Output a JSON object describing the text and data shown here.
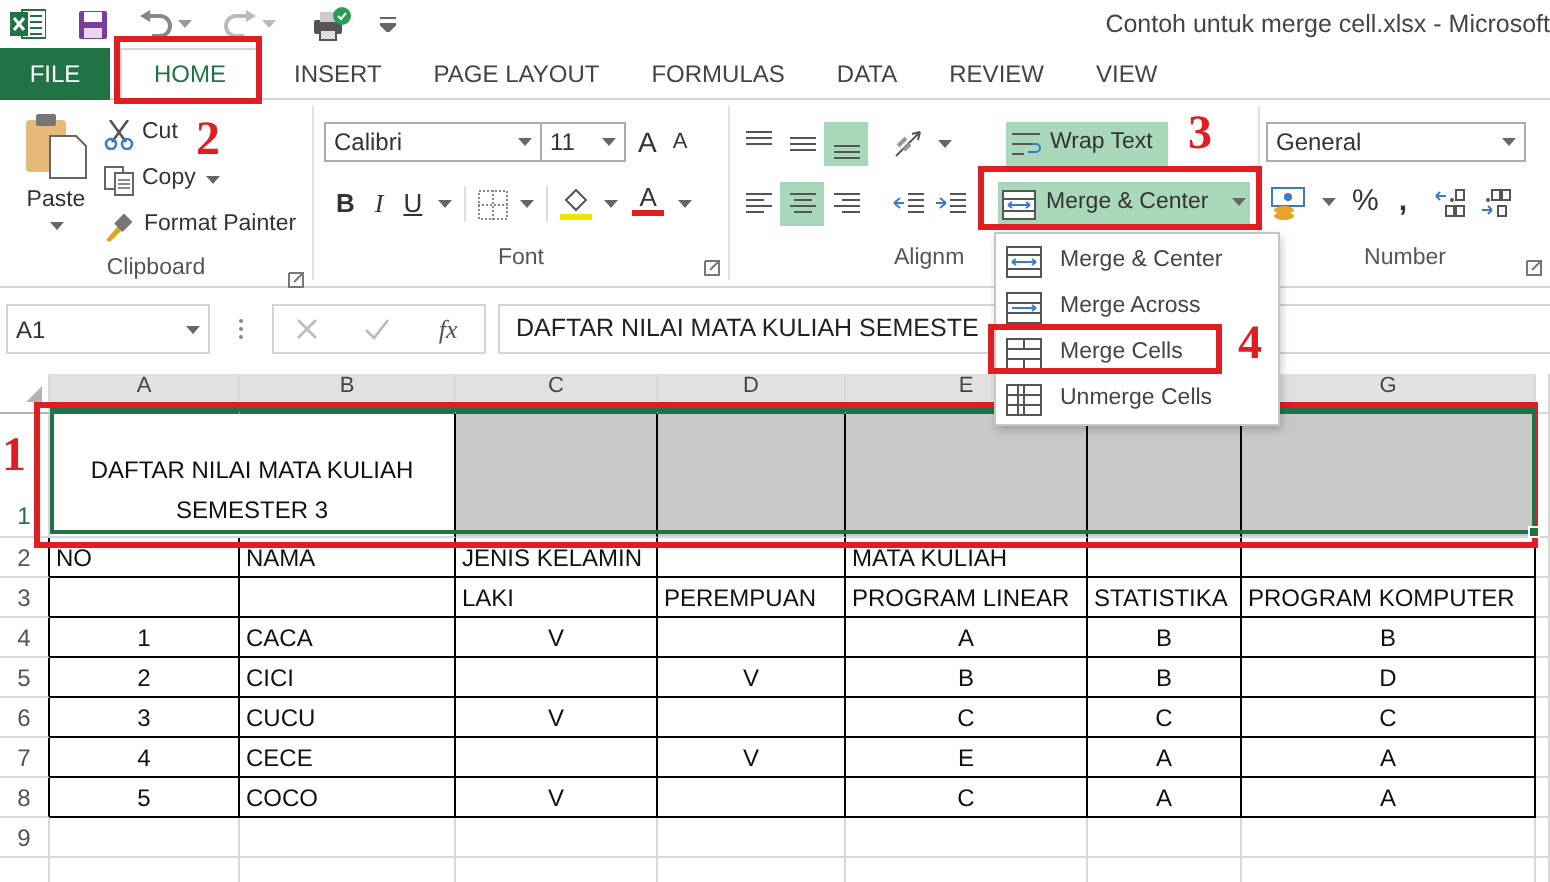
{
  "title_bar": {
    "title": "Contoh untuk merge cell.xlsx - Microsoft"
  },
  "tabs": [
    {
      "label": "FILE",
      "kind": "file",
      "selected": false
    },
    {
      "label": "HOME",
      "kind": "tab",
      "selected": true
    },
    {
      "label": "INSERT",
      "kind": "tab",
      "selected": false
    },
    {
      "label": "PAGE LAYOUT",
      "kind": "tab",
      "selected": false
    },
    {
      "label": "FORMULAS",
      "kind": "tab",
      "selected": false
    },
    {
      "label": "DATA",
      "kind": "tab",
      "selected": false
    },
    {
      "label": "REVIEW",
      "kind": "tab",
      "selected": false
    },
    {
      "label": "VIEW",
      "kind": "tab",
      "selected": false
    }
  ],
  "ribbon": {
    "clipboard": {
      "paste": "Paste",
      "cut": "Cut",
      "copy": "Copy",
      "format_painter": "Format Painter",
      "label": "Clipboard"
    },
    "font": {
      "font_name": "Calibri",
      "font_size": "11",
      "grow_font": "A",
      "shrink_font": "A",
      "bold": "B",
      "italic": "I",
      "underline": "U",
      "font_color": "A",
      "label": "Font"
    },
    "alignment": {
      "vertical": [
        {
          "on": false
        },
        {
          "on": false
        },
        {
          "on": true
        }
      ],
      "horizontal": [
        {
          "on": false
        },
        {
          "on": true
        },
        {
          "on": false
        }
      ],
      "wrap_text": {
        "label": "Wrap Text",
        "on": true
      },
      "merge_center": {
        "label": "Merge & Center",
        "on": true
      },
      "label": "Alignm"
    },
    "number": {
      "format": "General",
      "percent": "%",
      "comma": ",",
      "label": "Number"
    }
  },
  "merge_menu": [
    {
      "label": "Merge & Center"
    },
    {
      "label": "Merge Across"
    },
    {
      "label": "Merge Cells"
    },
    {
      "label": "Unmerge Cells"
    }
  ],
  "formula_bar": {
    "name_box": "A1",
    "function_label": "fx",
    "formula": "DAFTAR NILAI MATA KULIAH SEMESTE"
  },
  "sheet": {
    "columns": [
      "A",
      "B",
      "C",
      "D",
      "E",
      null,
      "G"
    ],
    "rows": [
      {
        "header": "1",
        "kind": "title",
        "selected": true,
        "cells": [
          "DAFTAR NILAI MATA KULIAH SEMESTER 3"
        ]
      },
      {
        "header": "2",
        "kind": "head",
        "cells": [
          "NO",
          "NAMA",
          "JENIS KELAMIN",
          null,
          "MATA KULIAH"
        ]
      },
      {
        "header": "3",
        "kind": "head",
        "cells": [
          null,
          null,
          "LAKI",
          "PEREMPUAN",
          "PROGRAM LINEAR",
          "STATISTIKA",
          "PROGRAM KOMPUTER"
        ]
      },
      {
        "header": "4",
        "kind": "data",
        "cells": [
          "1",
          "CACA",
          "V",
          null,
          "A",
          "B",
          "B"
        ]
      },
      {
        "header": "5",
        "kind": "data",
        "cells": [
          "2",
          "CICI",
          null,
          "V",
          "B",
          "B",
          "D"
        ]
      },
      {
        "header": "6",
        "kind": "data",
        "cells": [
          "3",
          "CUCU",
          "V",
          null,
          "C",
          "C",
          "C"
        ]
      },
      {
        "header": "7",
        "kind": "data",
        "cells": [
          "4",
          "CECE",
          null,
          "V",
          "E",
          "A",
          "A"
        ]
      },
      {
        "header": "8",
        "kind": "data",
        "cells": [
          "5",
          "COCO",
          "V",
          null,
          "C",
          "A",
          "A"
        ]
      },
      {
        "header": "9",
        "kind": "blank"
      },
      {
        "kind": "blank"
      }
    ]
  },
  "annotations": [
    {
      "number": "1"
    },
    {
      "number": "2"
    },
    {
      "number": "3"
    },
    {
      "number": "4"
    }
  ]
}
